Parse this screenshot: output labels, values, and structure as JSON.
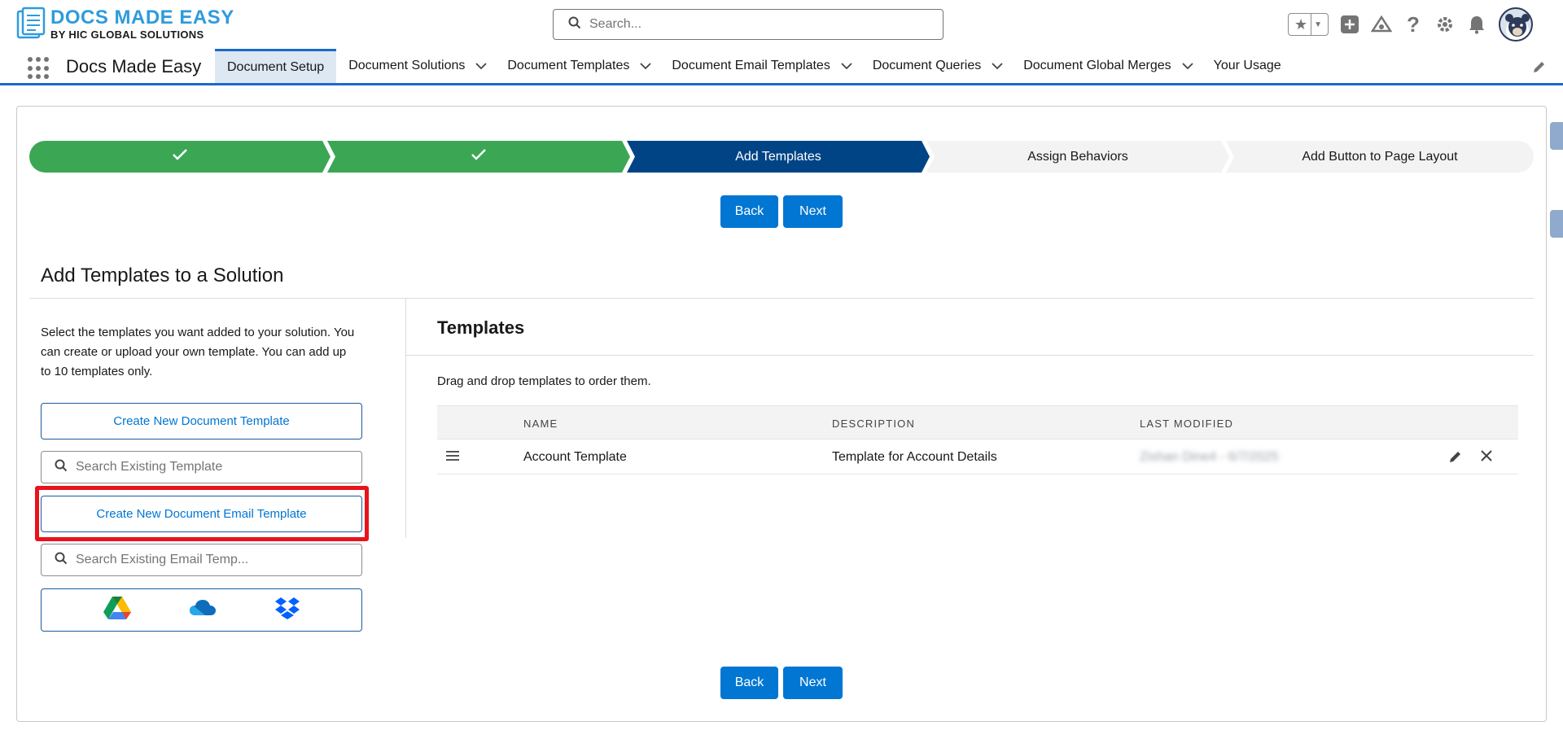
{
  "header": {
    "logo_title": "DOCS MADE EASY",
    "logo_subtitle": "BY HIC GLOBAL SOLUTIONS",
    "search_placeholder": "Search..."
  },
  "nav": {
    "app_name": "Docs Made Easy",
    "tabs": [
      {
        "label": "Document Setup",
        "active": true,
        "has_menu": false
      },
      {
        "label": "Document Solutions",
        "has_menu": true
      },
      {
        "label": "Document Templates",
        "has_menu": true
      },
      {
        "label": "Document Email Templates",
        "has_menu": true
      },
      {
        "label": "Document Queries",
        "has_menu": true
      },
      {
        "label": "Document Global Merges",
        "has_menu": true
      },
      {
        "label": "Your Usage",
        "has_menu": false
      }
    ]
  },
  "path": {
    "steps": [
      {
        "label": "",
        "status": "complete",
        "icon": "check-icon"
      },
      {
        "label": "",
        "status": "complete",
        "icon": "check-icon"
      },
      {
        "label": "Add Templates",
        "status": "current"
      },
      {
        "label": "Assign Behaviors",
        "status": "incomplete"
      },
      {
        "label": "Add Button to Page Layout",
        "status": "incomplete"
      }
    ]
  },
  "buttons": {
    "back": "Back",
    "next": "Next"
  },
  "section": {
    "title": "Add Templates to a Solution",
    "intro": "Select the templates you want added to your solution. You can create or upload your own template. You can add up to 10 templates only.",
    "create_template": "Create New Document Template",
    "search_template_placeholder": "Search Existing Template",
    "create_email_template": "Create New Document Email Template",
    "search_email_placeholder": "Search Existing Email Temp...",
    "cloud_sources": [
      "google-drive-icon",
      "onedrive-icon",
      "dropbox-icon"
    ]
  },
  "templates": {
    "title": "Templates",
    "hint": "Drag and drop templates to order them.",
    "columns": [
      "NAME",
      "DESCRIPTION",
      "LAST MODIFIED"
    ],
    "rows": [
      {
        "name": "Account Template",
        "description": "Template for Account Details",
        "last_modified": "Zishan Dine4 - 6/7/2025"
      }
    ]
  },
  "colors": {
    "brand": "#0176d3",
    "path_complete": "#3ba755",
    "path_current": "#014486",
    "highlight": "#e8131b"
  }
}
